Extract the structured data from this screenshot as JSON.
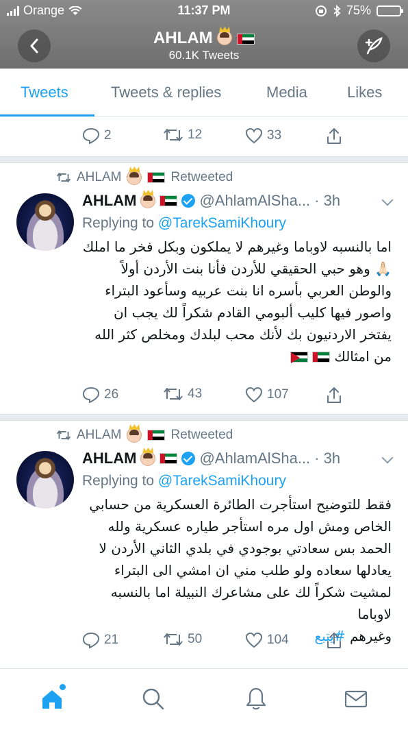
{
  "status_bar": {
    "carrier": "Orange",
    "time": "11:37 PM",
    "battery": "75%",
    "battery_level": 0.75
  },
  "header": {
    "title": "AHLAM",
    "subtitle": "60.1K Tweets",
    "back_icon": "back-chevron-icon",
    "compose_icon": "compose-feather-icon"
  },
  "tabs": [
    {
      "label": "Tweets",
      "active": true
    },
    {
      "label": "Tweets & replies",
      "active": false
    },
    {
      "label": "Media",
      "active": false
    },
    {
      "label": "Likes",
      "active": false
    }
  ],
  "top_actions": {
    "replies": "2",
    "retweets": "12",
    "likes": "33"
  },
  "tweets": [
    {
      "retweeted_by": "AHLAM",
      "retweeted_label": "Retweeted",
      "name": "AHLAM",
      "handle": "@AhlamAlSha...",
      "time": "· 3h",
      "replying_prefix": "Replying to",
      "replying_to": "@TarekSamiKhoury",
      "lines": [
        "اما بالنسبه لاوباما وغيرهم لا يملكون وبكل فخر ما املك",
        "🙏🏻 وهو حبي الحقيقي للأردن فأنا بنت الأردن أولاً",
        "والوطن العربي بأسره انا بنت عربيه وسأعود البتراء",
        "واصور فيها كليب ألبومي القادم شكراً لك يجب ان",
        "يفتخر الاردنيون بك لأنك محب لبلدك ومخلص كثر الله",
        "من امثالك"
      ],
      "actions": {
        "replies": "26",
        "retweets": "43",
        "likes": "107"
      }
    },
    {
      "retweeted_by": "AHLAM",
      "retweeted_label": "Retweeted",
      "name": "AHLAM",
      "handle": "@AhlamAlSha...",
      "time": "· 3h",
      "replying_prefix": "Replying to",
      "replying_to": "@TarekSamiKhoury",
      "lines": [
        "فقط للتوضيح استأجرت الطائرة العسكرية من حسابي",
        "الخاص ومش اول مره استأجر طياره عسكرية ولله",
        "الحمد بس سعادتي بوجودي في بلدي الثاني الأردن لا",
        "يعادلها سعاده ولو طلب مني ان امشي الى البتراء",
        "لمشيت شكراً لك على مشاعرك النبيلة اما بالنسبه لاوباما",
        "وغيرهم"
      ],
      "hashtag": "#يتبع",
      "actions": {
        "replies": "21",
        "retweets": "50",
        "likes": "104"
      }
    }
  ],
  "bottom_nav": [
    {
      "name": "home-icon",
      "active": true
    },
    {
      "name": "search-icon",
      "active": false
    },
    {
      "name": "notifications-bell-icon",
      "active": false
    },
    {
      "name": "messages-envelope-icon",
      "active": false
    }
  ],
  "colors": {
    "accent": "#1da1f2",
    "muted": "#657786",
    "text": "#14171a"
  }
}
